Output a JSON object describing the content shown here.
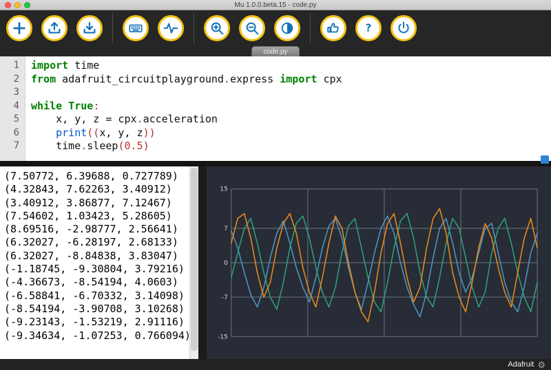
{
  "window": {
    "title": "Mu 1.0.0.beta.15 - code.py"
  },
  "toolbar": {
    "buttons": [
      {
        "name": "new",
        "icon": "plus-icon"
      },
      {
        "name": "load",
        "icon": "arrow-up-tray-icon"
      },
      {
        "name": "save",
        "icon": "arrow-down-tray-icon"
      },
      {
        "name": "serial",
        "icon": "keyboard-icon"
      },
      {
        "name": "plotter",
        "icon": "waveform-icon"
      },
      {
        "name": "zoom-in",
        "icon": "magnifier-plus-icon"
      },
      {
        "name": "zoom-out",
        "icon": "magnifier-minus-icon"
      },
      {
        "name": "theme",
        "icon": "contrast-circle-icon"
      },
      {
        "name": "check",
        "icon": "thumbs-up-icon"
      },
      {
        "name": "help",
        "icon": "question-mark-icon"
      },
      {
        "name": "quit",
        "icon": "power-icon"
      }
    ],
    "accent_ring_color": "#f2c114",
    "icon_color": "#1272b8"
  },
  "tab": {
    "label": "code.py"
  },
  "editor": {
    "lines": [
      {
        "num": 1,
        "tokens": [
          {
            "t": "import",
            "c": "kw"
          },
          {
            "t": " time",
            "c": "pl"
          }
        ]
      },
      {
        "num": 2,
        "tokens": [
          {
            "t": "from",
            "c": "kw"
          },
          {
            "t": " adafruit_circuitplayground",
            "c": "pl"
          },
          {
            "t": ".",
            "c": "op"
          },
          {
            "t": "express ",
            "c": "pl"
          },
          {
            "t": "import",
            "c": "kw"
          },
          {
            "t": " cpx",
            "c": "pl"
          }
        ]
      },
      {
        "num": 3,
        "tokens": []
      },
      {
        "num": 4,
        "tokens": [
          {
            "t": "while",
            "c": "kw"
          },
          {
            "t": " ",
            "c": "pl"
          },
          {
            "t": "True",
            "c": "kw"
          },
          {
            "t": ":",
            "c": "punct"
          }
        ]
      },
      {
        "num": 5,
        "tokens": [
          {
            "t": "    x, y, z = cpx",
            "c": "pl"
          },
          {
            "t": ".",
            "c": "op"
          },
          {
            "t": "acceleration",
            "c": "pl"
          }
        ]
      },
      {
        "num": 6,
        "tokens": [
          {
            "t": "    ",
            "c": "pl"
          },
          {
            "t": "print",
            "c": "builtin"
          },
          {
            "t": "((",
            "c": "punct"
          },
          {
            "t": "x, y, z",
            "c": "pl"
          },
          {
            "t": "))",
            "c": "punct"
          }
        ]
      },
      {
        "num": 7,
        "tokens": [
          {
            "t": "    time",
            "c": "pl"
          },
          {
            "t": ".",
            "c": "op"
          },
          {
            "t": "sleep",
            "c": "pl"
          },
          {
            "t": "(",
            "c": "punct"
          },
          {
            "t": "0.5",
            "c": "num"
          },
          {
            "t": ")",
            "c": "punct"
          }
        ]
      }
    ]
  },
  "repl": {
    "lines": [
      "(7.50772, 6.39688, 0.727789)",
      "(4.32843, 7.62263, 3.40912)",
      "(3.40912, 3.86877, 7.12467)",
      "(7.54602, 1.03423, 5.28605)",
      "(8.69516, -2.98777, 2.56641)",
      "(6.32027, -6.28197, 2.68133)",
      "(6.32027, -8.84838, 3.83047)",
      "(-1.18745, -9.30804, 3.79216)",
      "(-4.36673, -8.54194, 4.0603)",
      "(-6.58841, -6.70332, 3.14098)",
      "(-8.54194, -3.90708, 3.10268)",
      "(-9.23143, -1.53219, 2.91116)",
      "(-9.34634, -1.07253, 0.766094)"
    ]
  },
  "chart_data": {
    "type": "line",
    "title": "",
    "xlabel": "",
    "ylabel": "",
    "ylim": [
      -16.5,
      16.5
    ],
    "yticks": [
      15,
      7,
      0,
      -7,
      -15
    ],
    "x_gridlines": 5,
    "grid": true,
    "legend": "none",
    "background_color": "#272c36",
    "series": [
      {
        "name": "x",
        "color": "#4f93be",
        "values": [
          6.5,
          3,
          -2,
          -6.5,
          -9,
          -5,
          1,
          6,
          8.5,
          4,
          -1,
          -5,
          -8,
          -3,
          3,
          7.5,
          9,
          5,
          -1,
          -6,
          -9.5,
          -4,
          2,
          7,
          9.5,
          6,
          0,
          -5,
          -8.5,
          -11,
          -6,
          1,
          7,
          9,
          4,
          -2,
          -6,
          -3,
          2,
          7,
          8,
          2,
          -4,
          -8,
          -10,
          -5,
          2,
          6
        ]
      },
      {
        "name": "y",
        "color": "#2e9e7a",
        "values": [
          -3,
          2,
          7,
          9,
          4,
          -2,
          -7,
          -9.5,
          -4,
          3,
          8,
          9.5,
          5,
          -1,
          -6,
          -9,
          -5,
          2,
          7.5,
          9,
          3,
          -3,
          -8,
          -10,
          -4,
          3,
          8.5,
          10,
          5,
          -2,
          -7,
          -9,
          -3,
          4,
          9,
          7,
          1,
          -5,
          -9,
          -6,
          2,
          7,
          9,
          4,
          -2,
          -7,
          -10,
          -4
        ]
      },
      {
        "name": "z",
        "color": "#e8891d",
        "values": [
          4,
          9,
          10,
          5,
          -2,
          -7,
          -4,
          3,
          8,
          10,
          6,
          -1,
          -6,
          -9,
          -3,
          4,
          9.5,
          7,
          0,
          -6,
          -10,
          -12,
          -6,
          2,
          8,
          10,
          4,
          -3,
          -8,
          -5,
          3,
          9,
          11,
          6,
          -2,
          -7,
          -10,
          -4,
          3,
          8,
          5,
          -1,
          -6,
          -9,
          -2,
          5,
          9,
          3
        ]
      }
    ]
  },
  "footer": {
    "brand": "Adafruit",
    "gear_icon": "gear-icon"
  }
}
